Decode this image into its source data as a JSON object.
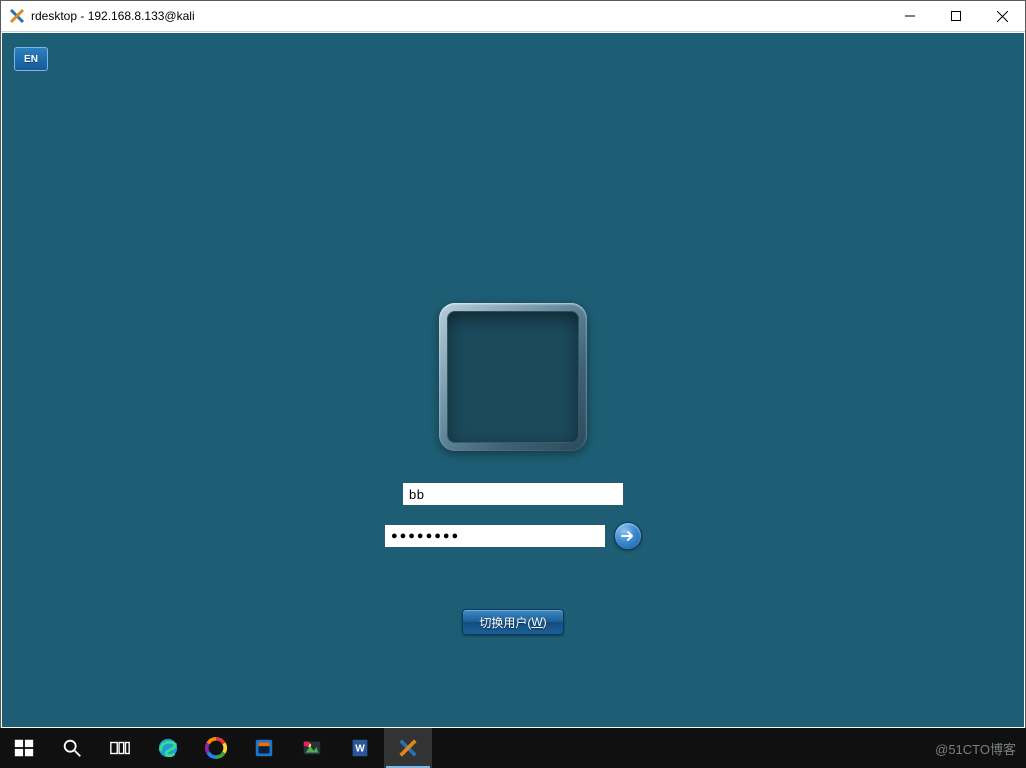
{
  "window": {
    "title": "rdesktop - 192.168.8.133@kali"
  },
  "session": {
    "lang_badge": "EN",
    "username_value": "bb",
    "password_value": "●●●●●●●●",
    "switch_user_label_prefix": "切换用户(",
    "switch_user_hotkey": "W",
    "switch_user_label_suffix": ")"
  },
  "watermark": "@51CTO博客"
}
